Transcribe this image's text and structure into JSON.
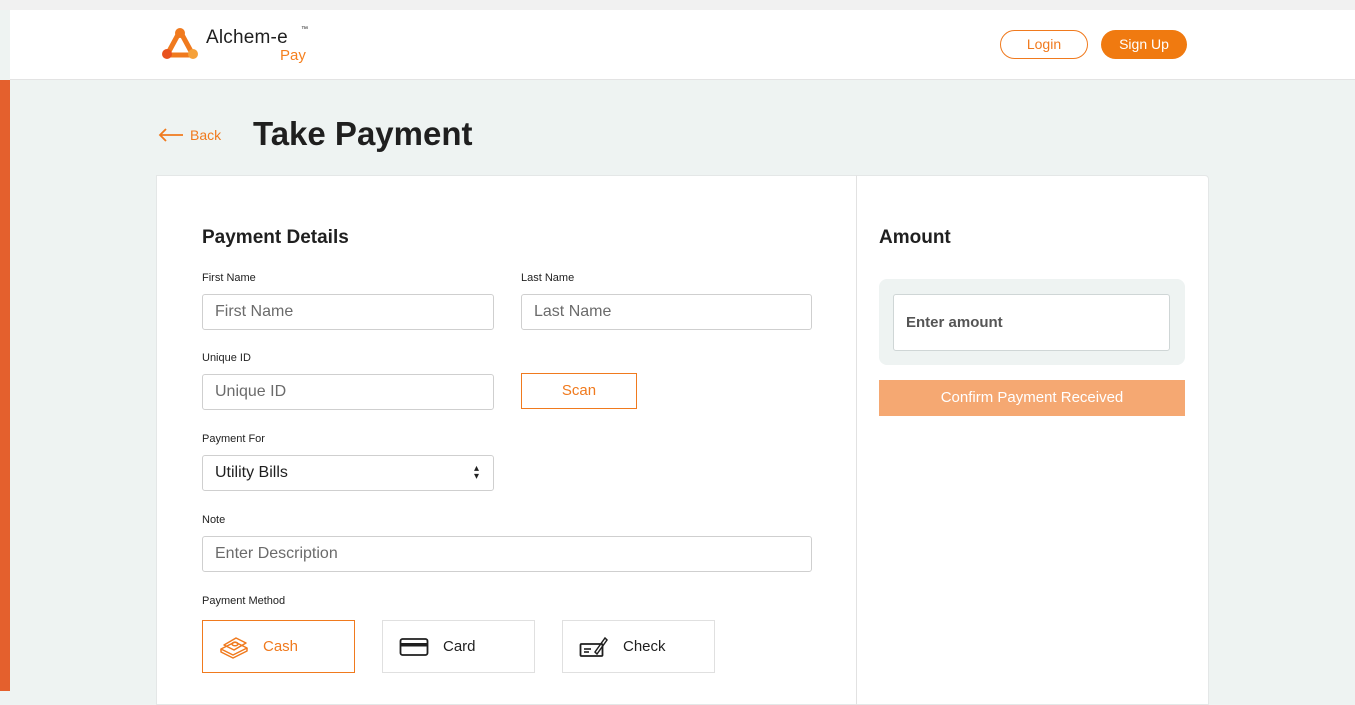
{
  "brand": {
    "name": "Alchem-e",
    "tm": "™",
    "sub": "Pay",
    "accent_color": "#f07a1e",
    "logo_icon": "triangle-nodes-icon"
  },
  "header": {
    "login_label": "Login",
    "signup_label": "Sign Up"
  },
  "page": {
    "back_label": "Back",
    "title": "Take Payment"
  },
  "payment_details": {
    "title": "Payment Details",
    "first_name": {
      "label": "First Name",
      "placeholder": "First Name"
    },
    "last_name": {
      "label": "Last Name",
      "placeholder": "Last Name"
    },
    "unique_id": {
      "label": "Unique ID",
      "placeholder": "Unique ID"
    },
    "scan_label": "Scan",
    "payment_for": {
      "label": "Payment For",
      "value": "Utility Bills"
    },
    "note": {
      "label": "Note",
      "placeholder": "Enter Description"
    },
    "payment_method": {
      "label": "Payment Method",
      "options": [
        {
          "label": "Cash",
          "icon": "cash-icon",
          "selected": true
        },
        {
          "label": "Card",
          "icon": "card-icon",
          "selected": false
        },
        {
          "label": "Check",
          "icon": "check-icon",
          "selected": false
        }
      ]
    }
  },
  "amount": {
    "title": "Amount",
    "placeholder": "Enter amount",
    "confirm_label": "Confirm Payment Received"
  }
}
